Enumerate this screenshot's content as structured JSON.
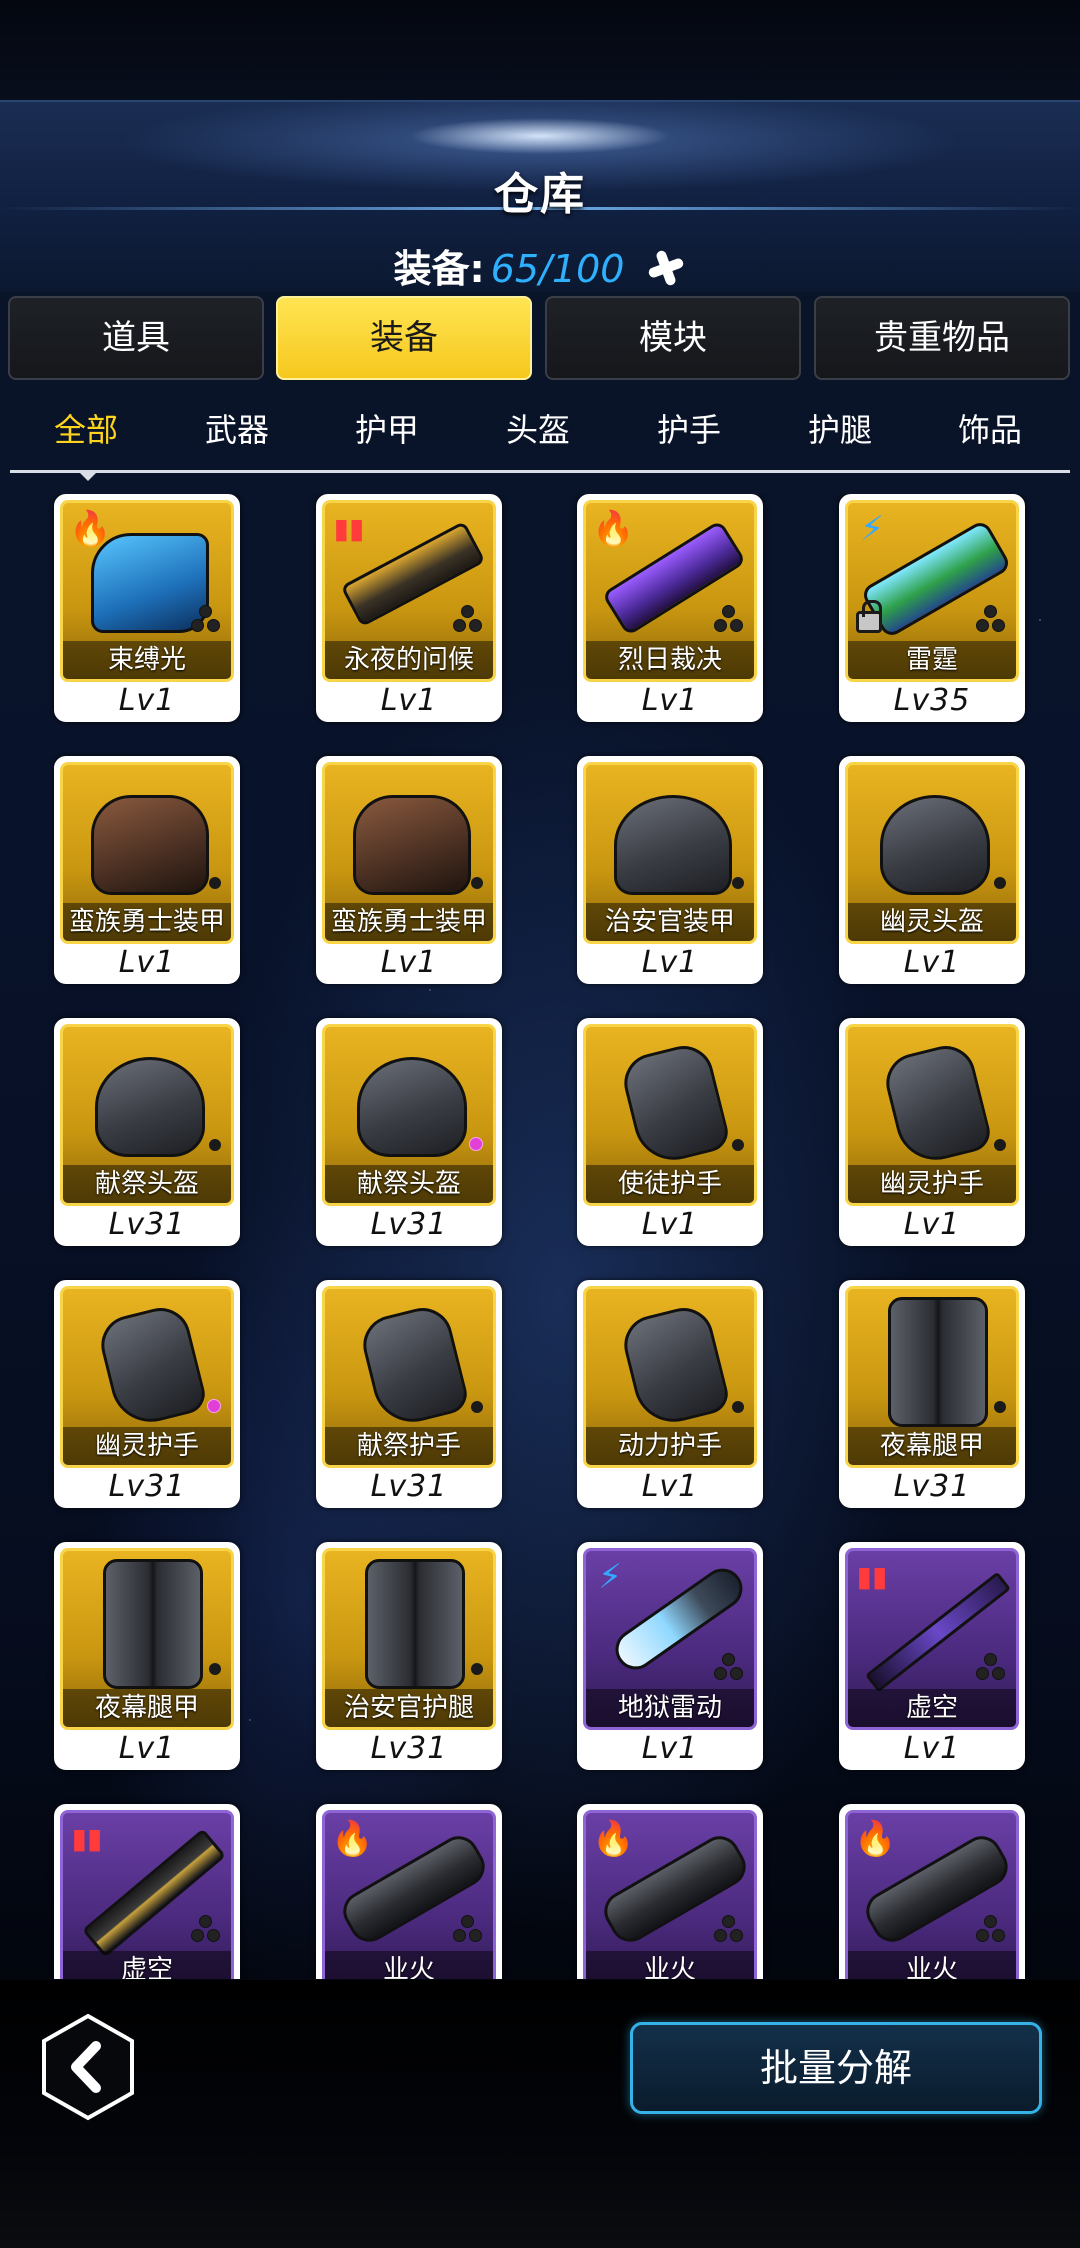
{
  "header": {
    "title": "仓库",
    "capacity_label": "装备:",
    "capacity_value": "65/100"
  },
  "main_tabs": [
    {
      "label": "道具",
      "active": false
    },
    {
      "label": "装备",
      "active": true
    },
    {
      "label": "模块",
      "active": false
    },
    {
      "label": "贵重物品",
      "active": false
    }
  ],
  "sub_tabs": [
    {
      "label": "全部",
      "active": true
    },
    {
      "label": "武器",
      "active": false
    },
    {
      "label": "护甲",
      "active": false
    },
    {
      "label": "头盔",
      "active": false
    },
    {
      "label": "护手",
      "active": false
    },
    {
      "label": "护腿",
      "active": false
    },
    {
      "label": "饰品",
      "active": false
    }
  ],
  "items": [
    {
      "name": "束缚光",
      "level": "Lv1",
      "rarity": "gold",
      "badge": "fire-icon",
      "shape": "weapon-blue",
      "slots": "three"
    },
    {
      "name": "永夜的问候",
      "level": "Lv1",
      "rarity": "gold",
      "badge": "ammo-icon",
      "shape": "weapon-rifle",
      "slots": "three"
    },
    {
      "name": "烈日裁决",
      "level": "Lv1",
      "rarity": "gold",
      "badge": "fire-icon",
      "shape": "weapon-purple",
      "slots": "three"
    },
    {
      "name": "雷霆",
      "level": "Lv35",
      "rarity": "gold",
      "badge": "bolt-icon",
      "shape": "weapon-green",
      "slots": "three",
      "locked": true
    },
    {
      "name": "蛮族勇士装甲",
      "level": "Lv1",
      "rarity": "gold",
      "shape": "armor",
      "slots": "one"
    },
    {
      "name": "蛮族勇士装甲",
      "level": "Lv1",
      "rarity": "gold",
      "shape": "armor",
      "slots": "one"
    },
    {
      "name": "治安官装甲",
      "level": "Lv1",
      "rarity": "gold",
      "shape": "armor-gray",
      "slots": "one"
    },
    {
      "name": "幽灵头盔",
      "level": "Lv1",
      "rarity": "gold",
      "shape": "helmet",
      "slots": "one"
    },
    {
      "name": "献祭头盔",
      "level": "Lv31",
      "rarity": "gold",
      "shape": "helmet",
      "slots": "one"
    },
    {
      "name": "献祭头盔",
      "level": "Lv31",
      "rarity": "gold",
      "shape": "helmet",
      "slots": "pink"
    },
    {
      "name": "使徒护手",
      "level": "Lv1",
      "rarity": "gold",
      "shape": "glove",
      "slots": "one"
    },
    {
      "name": "幽灵护手",
      "level": "Lv1",
      "rarity": "gold",
      "shape": "glove",
      "slots": "one"
    },
    {
      "name": "幽灵护手",
      "level": "Lv31",
      "rarity": "gold",
      "shape": "glove",
      "slots": "pink"
    },
    {
      "name": "献祭护手",
      "level": "Lv31",
      "rarity": "gold",
      "shape": "glove",
      "slots": "one"
    },
    {
      "name": "动力护手",
      "level": "Lv1",
      "rarity": "gold",
      "shape": "glove",
      "slots": "one"
    },
    {
      "name": "夜幕腿甲",
      "level": "Lv31",
      "rarity": "gold",
      "shape": "legs",
      "slots": "one"
    },
    {
      "name": "夜幕腿甲",
      "level": "Lv1",
      "rarity": "gold",
      "shape": "legs",
      "slots": "one"
    },
    {
      "name": "治安官护腿",
      "level": "Lv31",
      "rarity": "gold",
      "shape": "legs",
      "slots": "one"
    },
    {
      "name": "地狱雷动",
      "level": "Lv1",
      "rarity": "purple",
      "badge": "bolt-icon",
      "shape": "laser",
      "slots": "three"
    },
    {
      "name": "虚空",
      "level": "Lv1",
      "rarity": "purple",
      "badge": "ammo-icon",
      "shape": "sword",
      "slots": "three"
    },
    {
      "name": "虚空",
      "level": "",
      "rarity": "purple",
      "badge": "ammo-icon",
      "shape": "blade",
      "slots": "three"
    },
    {
      "name": "业火",
      "level": "",
      "rarity": "purple",
      "badge": "fire-icon",
      "shape": "gatling",
      "slots": "three"
    },
    {
      "name": "业火",
      "level": "",
      "rarity": "purple",
      "badge": "fire-icon",
      "shape": "gatling",
      "slots": "three"
    },
    {
      "name": "业火",
      "level": "",
      "rarity": "purple",
      "badge": "fire-icon",
      "shape": "gatling",
      "slots": "three"
    }
  ],
  "footer": {
    "batch_label": "批量分解"
  },
  "colors": {
    "accent_yellow": "#ffd41c",
    "capacity_blue": "#2fb0ff",
    "button_border": "#35b3e8"
  }
}
